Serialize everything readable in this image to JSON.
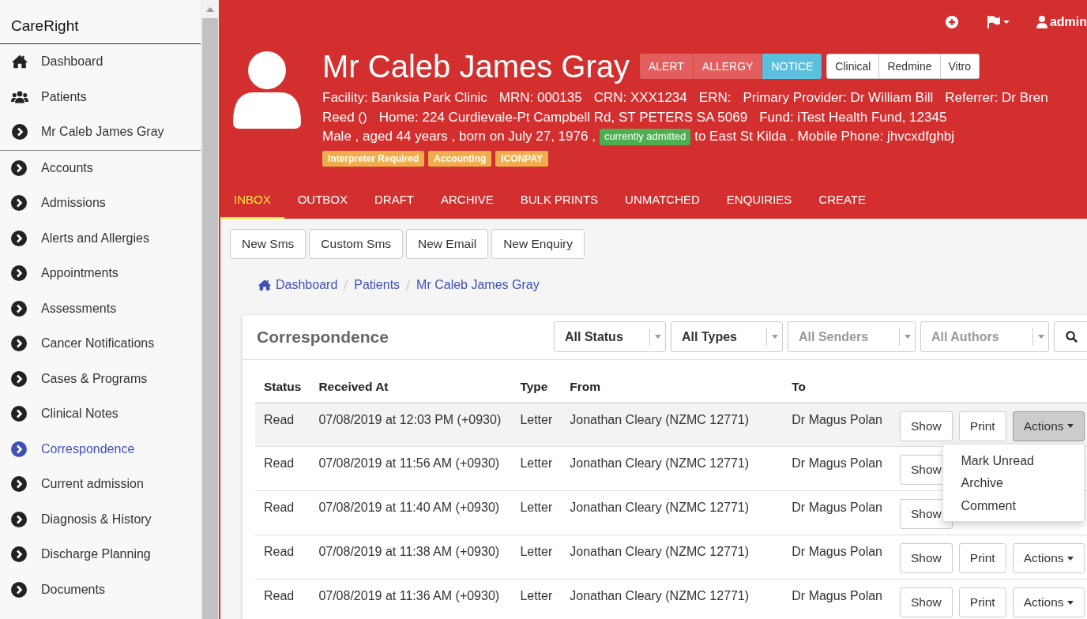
{
  "sidebar": {
    "brand": "CareRight",
    "top_items": [
      {
        "kind": "home",
        "label": "Dashboard",
        "selected": false
      },
      {
        "kind": "users",
        "label": "Patients",
        "selected": false
      },
      {
        "kind": "chevron",
        "label": "Mr Caleb James Gray",
        "selected": false
      }
    ],
    "items": [
      {
        "label": "Accounts",
        "selected": false
      },
      {
        "label": "Admissions",
        "selected": false
      },
      {
        "label": "Alerts and Allergies",
        "selected": false
      },
      {
        "label": "Appointments",
        "selected": false
      },
      {
        "label": "Assessments",
        "selected": false
      },
      {
        "label": "Cancer Notifications",
        "selected": false
      },
      {
        "label": "Cases & Programs",
        "selected": false
      },
      {
        "label": "Clinical Notes",
        "selected": false
      },
      {
        "label": "Correspondence",
        "selected": true
      },
      {
        "label": "Current admission",
        "selected": false
      },
      {
        "label": "Diagnosis & History",
        "selected": false
      },
      {
        "label": "Discharge Planning",
        "selected": false
      },
      {
        "label": "Documents",
        "selected": false
      }
    ]
  },
  "topbar": {
    "user": "admin"
  },
  "patient": {
    "name": "Mr Caleb James Gray",
    "flags": [
      {
        "label": "ALERT",
        "color": "#e35e5e"
      },
      {
        "label": "ALLERGY",
        "color": "#e35e5e"
      },
      {
        "label": "NOTICE",
        "color": "#5bc0de"
      }
    ],
    "links": [
      "Clinical",
      "Redmine",
      "Vitro"
    ],
    "lines": [
      [
        {
          "kind": "text",
          "text": "Facility: Banksia Park Clinic"
        },
        {
          "kind": "text",
          "text": "MRN: 000135"
        },
        {
          "kind": "text",
          "text": "CRN: XXX1234"
        },
        {
          "kind": "text",
          "text": "ERN:"
        },
        {
          "kind": "text",
          "text": "Primary Provider: Dr William Bill"
        },
        {
          "kind": "text",
          "text": "Referrer: Dr Bren"
        }
      ],
      [
        {
          "kind": "text",
          "text": "Reed ()"
        },
        {
          "kind": "text",
          "text": "Home: 224 Curdievale-Pt Campbell Rd, ST PETERS SA 5069"
        },
        {
          "kind": "text",
          "text": "Fund: iTest Health Fund, 12345"
        }
      ],
      [
        {
          "kind": "text",
          "text": "Male , aged 44 years , born on July 27, 1976 ,"
        },
        {
          "kind": "badge",
          "text": "currently admitted"
        },
        {
          "kind": "text",
          "text": "to East St Kilda . Mobile Phone: jhvcxdfghbj"
        }
      ]
    ],
    "tags": [
      "Interpreter Required",
      "Accounting",
      "ICONPAY"
    ]
  },
  "tabs": [
    {
      "label": "INBOX",
      "selected": true
    },
    {
      "label": "OUTBOX",
      "selected": false
    },
    {
      "label": "DRAFT",
      "selected": false
    },
    {
      "label": "ARCHIVE",
      "selected": false
    },
    {
      "label": "BULK PRINTS",
      "selected": false
    },
    {
      "label": "UNMATCHED",
      "selected": false
    },
    {
      "label": "ENQUIRIES",
      "selected": false
    },
    {
      "label": "CREATE",
      "selected": false
    }
  ],
  "actions": [
    "New Sms",
    "Custom Sms",
    "New Email",
    "New Enquiry"
  ],
  "breadcrumb": [
    "Dashboard",
    "Patients",
    "Mr Caleb James Gray"
  ],
  "correspondence": {
    "title": "Correspondence",
    "filters": [
      {
        "value": "All Status"
      },
      {
        "value": "All Types"
      },
      {
        "placeholder": "All Senders"
      },
      {
        "placeholder": "All Authors"
      }
    ],
    "columns": [
      "Status",
      "Received At",
      "Type",
      "From",
      "To"
    ],
    "rows": [
      {
        "status": "Read",
        "received": "07/08/2019 at 12:03 PM (+0930)",
        "type": "Letter",
        "from": "Jonathan Cleary (NZMC 12771)",
        "to": "Dr Magus Polan",
        "buttons": [
          "Show",
          "Print",
          "Actions"
        ],
        "selected": true,
        "menu": [
          "Mark Unread",
          "Archive",
          "Comment"
        ]
      },
      {
        "status": "Read",
        "received": "07/08/2019 at 11:56 AM (+0930)",
        "type": "Letter",
        "from": "Jonathan Cleary (NZMC 12771)",
        "to": "Dr Magus Polan",
        "buttons": [
          "Show"
        ],
        "selected": false
      },
      {
        "status": "Read",
        "received": "07/08/2019 at 11:40 AM (+0930)",
        "type": "Letter",
        "from": "Jonathan Cleary (NZMC 12771)",
        "to": "Dr Magus Polan",
        "buttons": [
          "Show"
        ],
        "selected": false
      },
      {
        "status": "Read",
        "received": "07/08/2019 at 11:38 AM (+0930)",
        "type": "Letter",
        "from": "Jonathan Cleary (NZMC 12771)",
        "to": "Dr Magus Polan",
        "buttons": [
          "Show",
          "Print",
          "Actions"
        ],
        "selected": false
      },
      {
        "status": "Read",
        "received": "07/08/2019 at 11:36 AM (+0930)",
        "type": "Letter",
        "from": "Jonathan Cleary (NZMC 12771)",
        "to": "Dr Magus Polan",
        "buttons": [
          "Show",
          "Print",
          "Actions"
        ],
        "selected": false
      }
    ]
  }
}
